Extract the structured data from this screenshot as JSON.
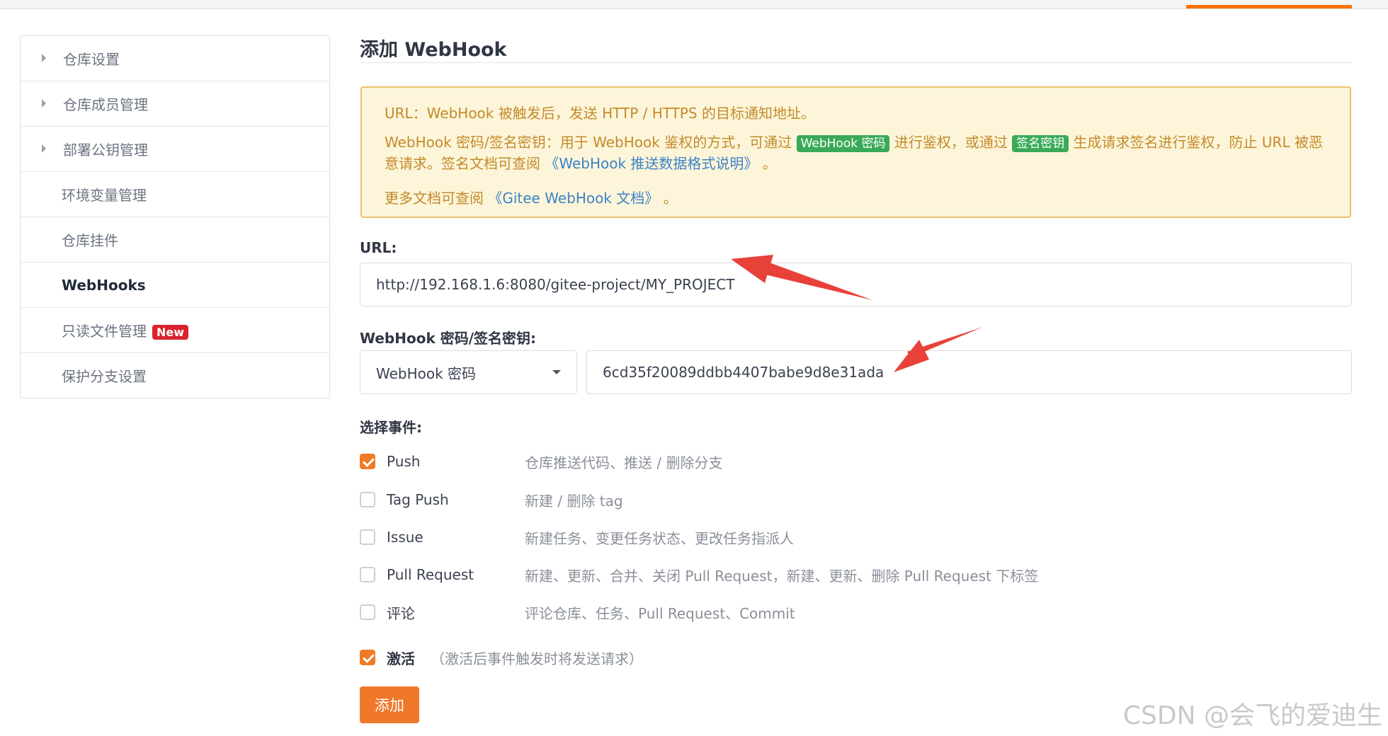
{
  "sidebar": {
    "items": [
      {
        "label": "仓库设置"
      },
      {
        "label": "仓库成员管理"
      },
      {
        "label": "部署公钥管理"
      },
      {
        "label": "环境变量管理"
      },
      {
        "label": "仓库挂件"
      },
      {
        "label": "WebHooks"
      },
      {
        "label": "只读文件管理",
        "badge": "New"
      },
      {
        "label": "保护分支设置"
      }
    ]
  },
  "page": {
    "title": "添加 WebHook"
  },
  "notice": {
    "line1": "URL：WebHook 被触发后，发送 HTTP / HTTPS 的目标通知地址。",
    "line2_a": "WebHook 密码/签名密钥：用于 WebHook 鉴权的方式，可通过",
    "tag_password": "WebHook 密码",
    "line2_b": "进行鉴权，或通过",
    "tag_secret": "签名密钥",
    "line2_c": "生成请求签名进行鉴权，防止 URL 被恶意请求。签名文档可查阅",
    "link_format": "《WebHook 推送数据格式说明》",
    "line2_end": "。",
    "line3_a": "更多文档可查阅",
    "link_docs": "《Gitee WebHook 文档》",
    "line3_end": "。"
  },
  "form": {
    "url_label": "URL:",
    "url_value": "http://192.168.1.6:8080/gitee-project/MY_PROJECT",
    "secret_label": "WebHook 密码/签名密钥:",
    "secret_type": "WebHook 密码",
    "secret_value": "6cd35f20089ddbb4407babe9d8e31ada",
    "events_label": "选择事件:",
    "events": [
      {
        "name": "Push",
        "desc": "仓库推送代码、推送 / 删除分支",
        "checked": true
      },
      {
        "name": "Tag Push",
        "desc": "新建 / 删除 tag",
        "checked": false
      },
      {
        "name": "Issue",
        "desc": "新建任务、变更任务状态、更改任务指派人",
        "checked": false
      },
      {
        "name": "Pull Request",
        "desc": "新建、更新、合并、关闭 Pull Request，新建、更新、删除 Pull Request 下标签",
        "checked": false
      },
      {
        "name": "评论",
        "desc": "评论仓库、任务、Pull Request、Commit",
        "checked": false
      }
    ],
    "activate_label": "激活",
    "activate_hint": "（激活后事件触发时将发送请求）",
    "activate_checked": true,
    "submit_label": "添加"
  },
  "watermark": "CSDN @会飞的爱迪生",
  "colors": {
    "accent": "#f0782a",
    "notice_bg": "#fcf5d9",
    "notice_border": "#e8c370",
    "arrow": "#e8413a"
  }
}
